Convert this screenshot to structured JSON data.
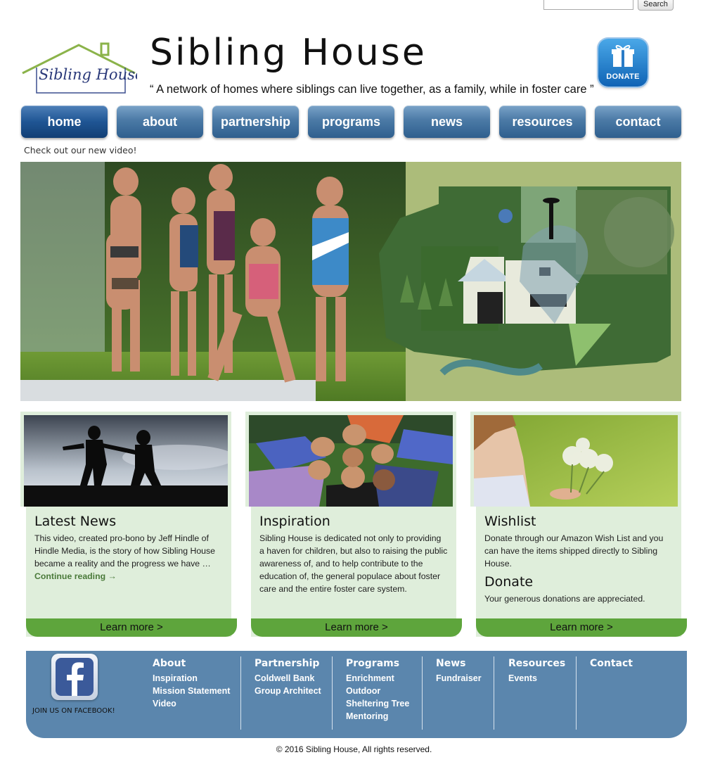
{
  "search": {
    "value": "",
    "button_label": "Search"
  },
  "header": {
    "logo_text": "Sibling House",
    "title": "Sibling House",
    "tagline": "“ A network of homes where siblings can live together, as a family, while in foster care ”",
    "donate_label": "DONATE"
  },
  "nav": [
    {
      "label": "home",
      "active": true
    },
    {
      "label": "about"
    },
    {
      "label": "partnership"
    },
    {
      "label": "programs"
    },
    {
      "label": "news"
    },
    {
      "label": "resources"
    },
    {
      "label": "contact"
    }
  ],
  "video_link": "Check out our new video!",
  "cards": [
    {
      "heading": "Latest News",
      "text": "This video, created pro-bono by Jeff Hindle of Hindle Media, is the story of how Sibling House became a reality and the progress we have …",
      "link": "Continue reading →",
      "button": "Learn more >"
    },
    {
      "heading": "Inspiration",
      "text": "Sibling House is dedicated not only to providing a haven for children, but also to raising the public awareness of, and to help contribute to the education of, the general populace about foster care and the entire foster care system.",
      "button": "Learn more >"
    },
    {
      "heading": "Wishlist",
      "text": "Donate through our Amazon Wish List and you can have the items shipped directly to Sibling House.",
      "heading2": "Donate",
      "text2": "Your generous donations are appreciated.",
      "button": "Learn more >"
    }
  ],
  "footer": {
    "facebook_label": "JOIN US ON FACEBOOK!",
    "columns": [
      {
        "heading": "About",
        "links": [
          "Inspiration",
          "Mission Statement",
          "Video"
        ]
      },
      {
        "heading": "Partnership",
        "links": [
          "Coldwell Bank",
          "Group Architect"
        ]
      },
      {
        "heading": "Programs",
        "links": [
          "Enrichment",
          "Outdoor",
          "Sheltering Tree",
          "Mentoring"
        ]
      },
      {
        "heading": "News",
        "links": [
          "Fundraiser"
        ]
      },
      {
        "heading": "Resources",
        "links": [
          "Events"
        ]
      },
      {
        "heading": "Contact",
        "links": []
      }
    ]
  },
  "copyright": "© 2016 Sibling House, All rights reserved.",
  "colors": {
    "nav_blue": "#2f5f8e",
    "card_green": "#dfeedb",
    "button_green": "#5ea53c",
    "footer_blue": "#5b86ad"
  }
}
